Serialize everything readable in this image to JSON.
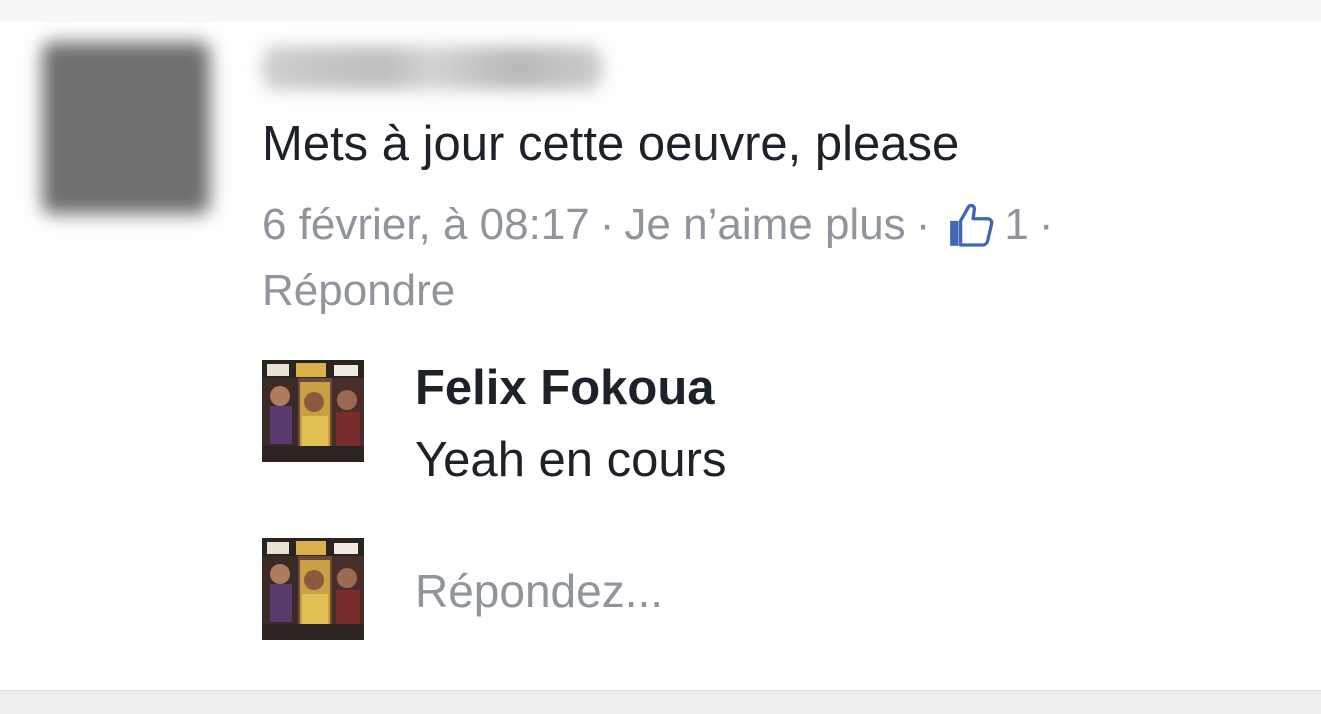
{
  "comment": {
    "text": "Mets à jour cette oeuvre, please",
    "timestamp": "6 février, à 08:17",
    "separator": "·",
    "like_action": "Je n’aime plus",
    "like_count": "1",
    "reply_action": "Répondre"
  },
  "reply": {
    "author": "Felix Fokoua",
    "text": "Yeah en cours"
  },
  "reply_box": {
    "placeholder": "Répondez..."
  },
  "colors": {
    "text_primary": "#1d2129",
    "text_secondary": "#90949c",
    "like_blue": "#4267b2"
  },
  "icons": {
    "like": "thumbs-up-icon"
  }
}
